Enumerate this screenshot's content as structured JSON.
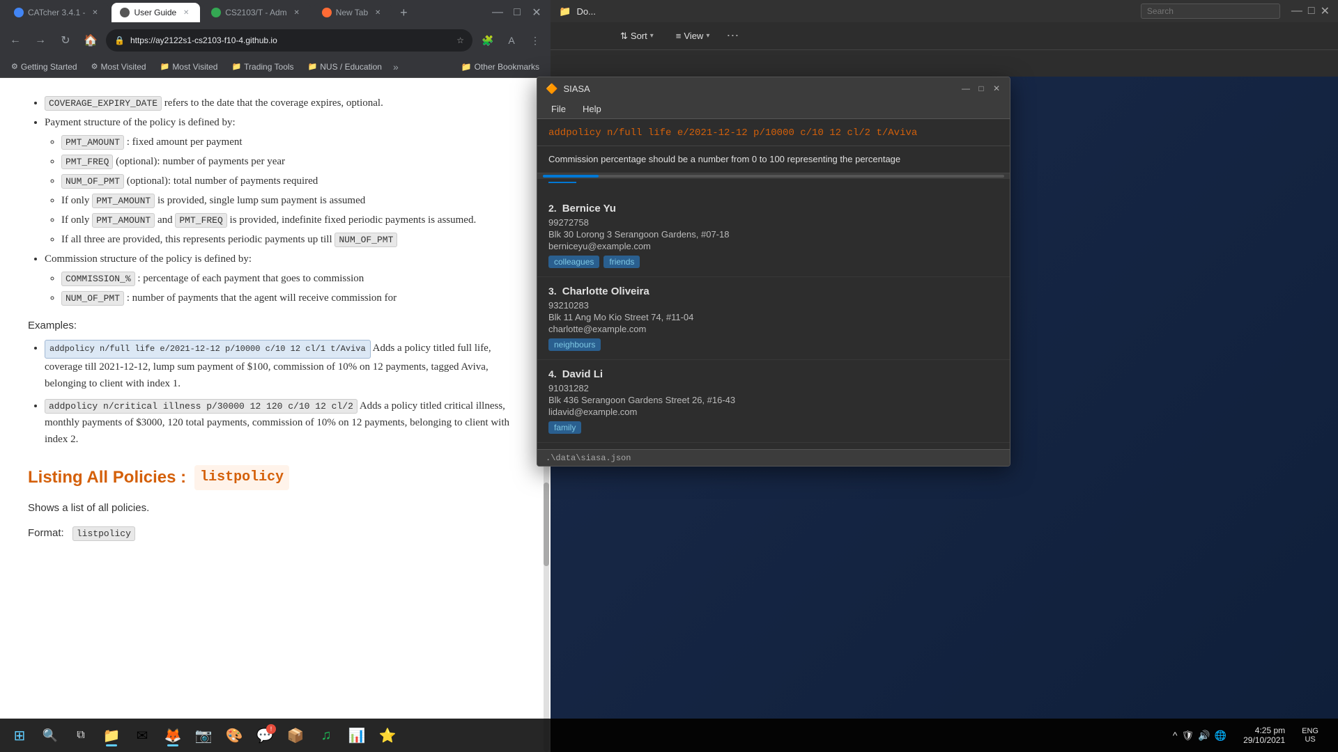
{
  "browser": {
    "tabs": [
      {
        "id": "catcher",
        "label": "CATcher 3.4.1 -",
        "active": false,
        "icon_color": "#4285f4"
      },
      {
        "id": "userguide",
        "label": "User Guide",
        "active": true,
        "icon_color": "#ffffff"
      },
      {
        "id": "cs2103",
        "label": "CS2103/T - Adm",
        "active": false,
        "icon_color": "#34a853"
      },
      {
        "id": "newtab",
        "label": "New Tab",
        "active": false,
        "icon_color": "#ff6b35"
      }
    ],
    "address": "https://ay2122s1-cs2103-f10-4.github.io",
    "bookmarks": [
      {
        "label": "Getting Started",
        "icon": "⚙"
      },
      {
        "label": "Most Visited",
        "icon": "⚙"
      },
      {
        "label": "Most Visited",
        "icon": "📁"
      },
      {
        "label": "Trading Tools",
        "icon": "📁"
      },
      {
        "label": "NUS / Education",
        "icon": "📁"
      }
    ],
    "other_bookmarks_label": "Other Bookmarks",
    "sort_label": "Sort",
    "view_label": "View"
  },
  "content": {
    "coverage_line": "refers to the date that the coverage expires, optional.",
    "coverage_tag": "COVERAGE_EXPIRY_DATE",
    "payment_structure": "Payment structure of the policy is defined by:",
    "pmt_items": [
      {
        "tag": "PMT_AMOUNT",
        "desc": ": fixed amount per payment"
      },
      {
        "tag": "PMT_FREQ",
        "desc": " (optional): number of payments per year"
      },
      {
        "tag": "NUM_OF_PMT",
        "desc": " (optional): total number of payments required"
      }
    ],
    "if_only_lines": [
      {
        "prefix": "If only",
        "tag": "PMT_AMOUNT",
        "suffix": "is provided, single lump sum payment is assumed"
      },
      {
        "prefix": "If only",
        "tag": "PMT_AMOUNT",
        "mid": "and",
        "tag2": "PMT_FREQ",
        "suffix": "is provided, indefinite fixed periodic payments is assumed."
      },
      {
        "prefix": "If all three are provided, this represents periodic payments up till",
        "tag": "NUM_OF_PMT"
      }
    ],
    "commission_line": "Commission structure of the policy is defined by:",
    "commission_items": [
      {
        "tag": "COMMISSION_%",
        "desc": ": percentage of each payment that goes to commission"
      },
      {
        "tag": "NUM_OF_PMT",
        "desc": ": number of payments that the agent will receive commission for"
      }
    ],
    "examples_label": "Examples:",
    "example1_code": "addpolicy n/full life e/2021-12-12 p/10000 c/10 12 cl/1 t/Aviva",
    "example1_desc": "Adds a policy titled full life, coverage till 2021-12-12, lump sum payment of $100, commission of 10% on 12 payments, tagged Aviva, belonging to client with index 1.",
    "example2_code": "addpolicy n/critical illness p/30000 12 120 c/10 12 cl/2",
    "example2_desc": "Adds a policy titled critical illness, monthly payments of $3000, 120 total payments, commission of 10% on 12 payments, belonging to client with index 2.",
    "listing_title": "Listing All Policies :",
    "listing_cmd": "listpolicy",
    "listing_desc": "Shows a list of all policies.",
    "format_label": "Format:",
    "format_cmd": "listpolicy"
  },
  "siasa": {
    "title": "SIASA",
    "menu": [
      "File",
      "Help"
    ],
    "command": "addpolicy n/full life e/2021-12-12 p/10000 c/10 12 cl/2 t/Aviva",
    "output": "Commission percentage should be a number from 0 to 100 representing the percentage",
    "contacts": [
      {
        "number": "2.",
        "name": "Bernice Yu",
        "phone": "99272758",
        "address": "Blk 30 Lorong 3 Serangoon Gardens, #07-18",
        "email": "berniceyu@example.com",
        "tags": [
          "colleagues",
          "friends"
        ]
      },
      {
        "number": "3.",
        "name": "Charlotte Oliveira",
        "phone": "93210283",
        "address": "Blk 11 Ang Mo Kio Street 74, #11-04",
        "email": "charlotte@example.com",
        "tags": [
          "neighbours"
        ]
      },
      {
        "number": "4.",
        "name": "David Li",
        "phone": "91031282",
        "address": "Blk 436 Serangoon Gardens Street 26, #16-43",
        "email": "lidavid@example.com",
        "tags": [
          "family"
        ]
      }
    ],
    "status": ".\\data\\siasa.json"
  },
  "file_explorer": {
    "title": "Do...",
    "sort_label": "Sort",
    "view_label": "View"
  },
  "taskbar": {
    "time": "4:25 pm",
    "date": "29/10/2021",
    "locale": "ENG\nUS"
  }
}
